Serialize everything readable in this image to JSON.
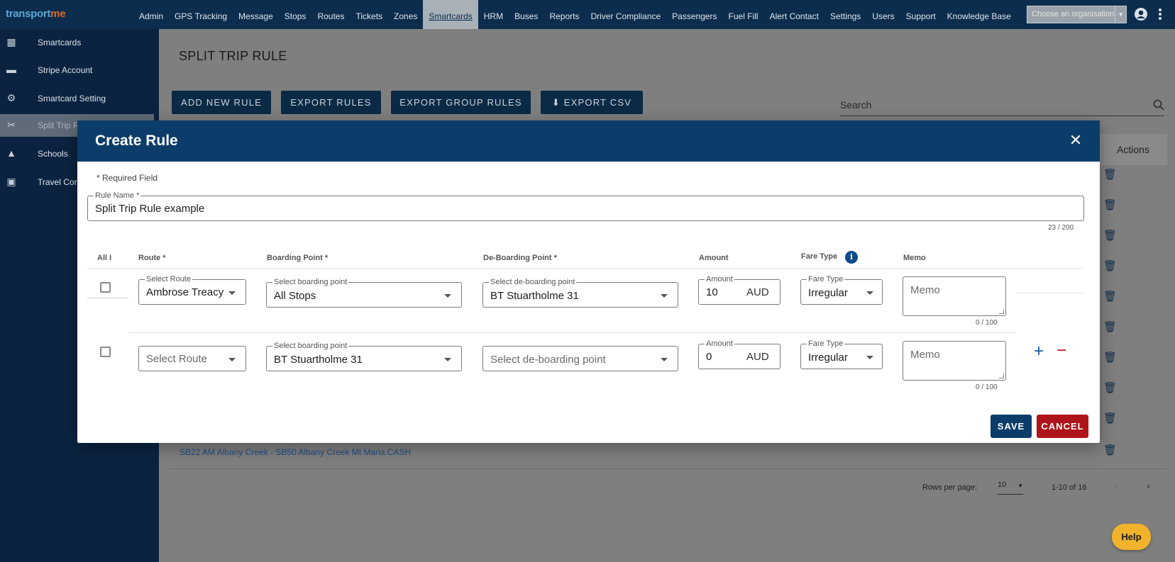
{
  "brand": {
    "part1": "transp",
    "part2": "o",
    "part3": "rt",
    "part4": "me"
  },
  "nav": {
    "items": [
      "Admin",
      "GPS Tracking",
      "Message",
      "Stops",
      "Routes",
      "Tickets",
      "Zones",
      "Smartcards",
      "HRM",
      "Buses",
      "Reports",
      "Driver Compliance",
      "Passengers",
      "Fuel Fill",
      "Alert Contact",
      "Settings",
      "Users",
      "Support",
      "Knowledge Base"
    ],
    "active": "Smartcards",
    "org_placeholder": "Choose an organisation"
  },
  "sidebar": {
    "items": [
      {
        "label": "Smartcards",
        "icon": "table-icon"
      },
      {
        "label": "Stripe Account",
        "icon": "card-icon"
      },
      {
        "label": "Smartcard Setting",
        "icon": "gear-icon"
      },
      {
        "label": "Split Trip R",
        "icon": "split-icon"
      },
      {
        "label": "Schools",
        "icon": "school-icon"
      },
      {
        "label": "Travel Con",
        "icon": "travel-icon"
      }
    ],
    "active_index": 3
  },
  "page": {
    "title": "SPLIT TRIP RULE",
    "buttons": {
      "add": "ADD NEW RULE",
      "export_rules": "EXPORT RULES",
      "export_group": "EXPORT GROUP RULES",
      "export_csv": "EXPORT CSV"
    },
    "search_placeholder": "Search",
    "actions_header": "Actions",
    "visible_row": "SB22 AM Albany Creek - SB50 Albany Creek Mt Maria CASH",
    "pagination": {
      "rows_per_page_label": "Rows per page:",
      "rows_per_page": "10",
      "range": "1-10 of 16"
    }
  },
  "help_label": "Help",
  "modal": {
    "title": "Create Rule",
    "required_note": "* Required Field",
    "rule_name": {
      "label": "Rule Name *",
      "value": "Split Trip Rule example",
      "counter": "23 / 200"
    },
    "columns": {
      "all": "All I",
      "route": "Route *",
      "boarding": "Boarding Point *",
      "deboarding": "De-Boarding Point *",
      "amount": "Amount",
      "fare_type": "Fare Type",
      "memo": "Memo"
    },
    "rows": [
      {
        "route_label": "Select Route",
        "route": "Ambrose Treacy",
        "boarding_label": "Select boarding point",
        "boarding": "All Stops",
        "deboarding_label": "Select de-boarding point",
        "deboarding": "BT Stuartholme 31",
        "amount_label": "Amount",
        "amount": "10",
        "currency": "AUD",
        "fare_label": "Fare Type",
        "fare": "Irregular",
        "memo_placeholder": "Memo",
        "memo_counter": "0 / 100"
      },
      {
        "route_placeholder": "Select Route",
        "boarding_label": "Select boarding point",
        "boarding": "BT Stuartholme 31",
        "deboarding_placeholder": "Select de-boarding point",
        "amount_label": "Amount",
        "amount": "0",
        "currency": "AUD",
        "fare_label": "Fare Type",
        "fare": "Irregular",
        "memo_placeholder": "Memo",
        "memo_counter": "0 / 100"
      }
    ],
    "add_row": "+",
    "remove_row": "−",
    "close": "✕",
    "info": "i",
    "save": "SAVE",
    "cancel": "CANCEL"
  }
}
